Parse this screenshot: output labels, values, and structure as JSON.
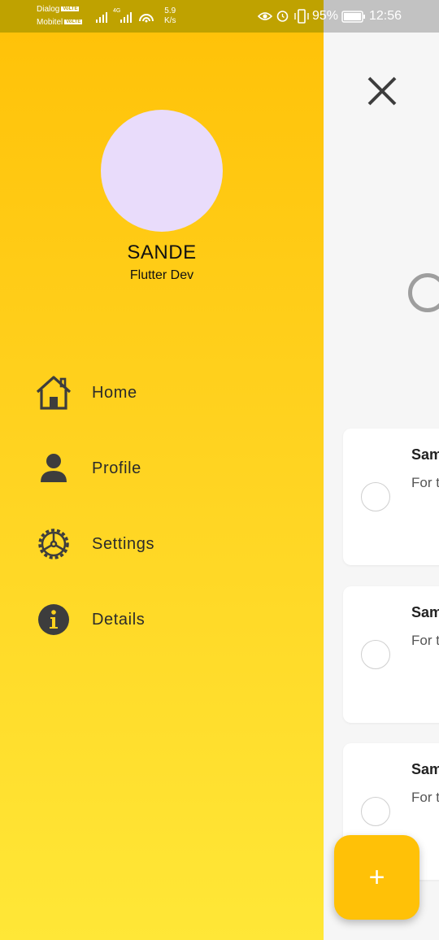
{
  "status_bar": {
    "carrier1": "Dialog",
    "carrier2": "Mobitel",
    "volte": "VoLTE",
    "network_type": "4G",
    "speed_value": "5.9",
    "speed_unit": "K/s",
    "battery": "95%",
    "time": "12:56"
  },
  "drawer": {
    "user_name": "SANDE",
    "user_role": "Flutter Dev",
    "menu": [
      {
        "label": "Home",
        "icon": "home-icon"
      },
      {
        "label": "Profile",
        "icon": "person-icon"
      },
      {
        "label": "Settings",
        "icon": "gear-icon"
      },
      {
        "label": "Details",
        "icon": "info-icon"
      }
    ]
  },
  "main": {
    "cards": [
      {
        "title": "Sam",
        "desc": "For t"
      },
      {
        "title": "Sam",
        "desc": "For t"
      },
      {
        "title": "Sam",
        "desc": "For t"
      }
    ],
    "fab_label": "+"
  },
  "colors": {
    "drawer_top": "#ffc107",
    "drawer_bottom": "#ffe737",
    "fab": "#ffc107",
    "avatar": "#e9dcfb",
    "icon_dark": "#3d3d3d"
  }
}
